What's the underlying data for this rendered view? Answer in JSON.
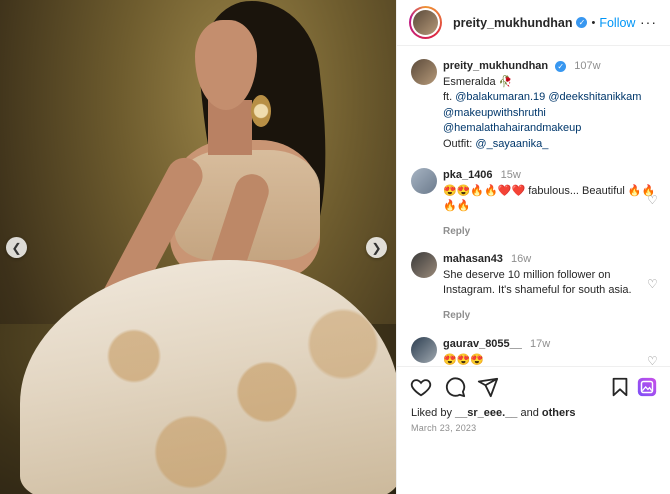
{
  "post": {
    "username": "preity_mukhundhan",
    "follow_label": "Follow",
    "more_label": "···"
  },
  "caption": {
    "username": "preity_mukhundhan",
    "time": "107w",
    "line1": "Esmeralda 🥀",
    "line2_prefix": "ft. ",
    "mention1": "@balakumaran.19",
    "mention2": "@deekshitanikkam",
    "mention3": "@makeupwithshruthi",
    "mention4": "@hemalathahairandmakeup",
    "outfit_prefix": "Outfit: ",
    "mention5": "@_sayaanika_"
  },
  "comments": [
    {
      "username": "pka_1406",
      "time": "15w",
      "text": "😍😍🔥🔥❤️❤️ fabulous... Beautiful 🔥🔥🔥🔥",
      "reply_label": "Reply"
    },
    {
      "username": "mahasan43",
      "time": "16w",
      "text": "She deserve 10 million follower on Instagram. It's shameful for south asia.",
      "reply_label": "Reply"
    },
    {
      "username": "gaurav_8055__",
      "time": "17w",
      "text": "😍😍😍",
      "reply_label": ""
    }
  ],
  "footer": {
    "liked_prefix": "Liked by ",
    "liked_user": "__sr_eee.__",
    "liked_mid": " and ",
    "liked_others": "others",
    "date": "March 23, 2023"
  },
  "colors": {
    "accent": "#0095f6",
    "verified": "#3897f0",
    "muted": "#8e8e8e",
    "link": "#00376b"
  },
  "icons": [
    "chevron-left-icon",
    "chevron-right-icon",
    "verified-icon",
    "more-icon",
    "heart-icon",
    "comment-icon",
    "share-icon",
    "bookmark-icon",
    "gallery-icon"
  ]
}
